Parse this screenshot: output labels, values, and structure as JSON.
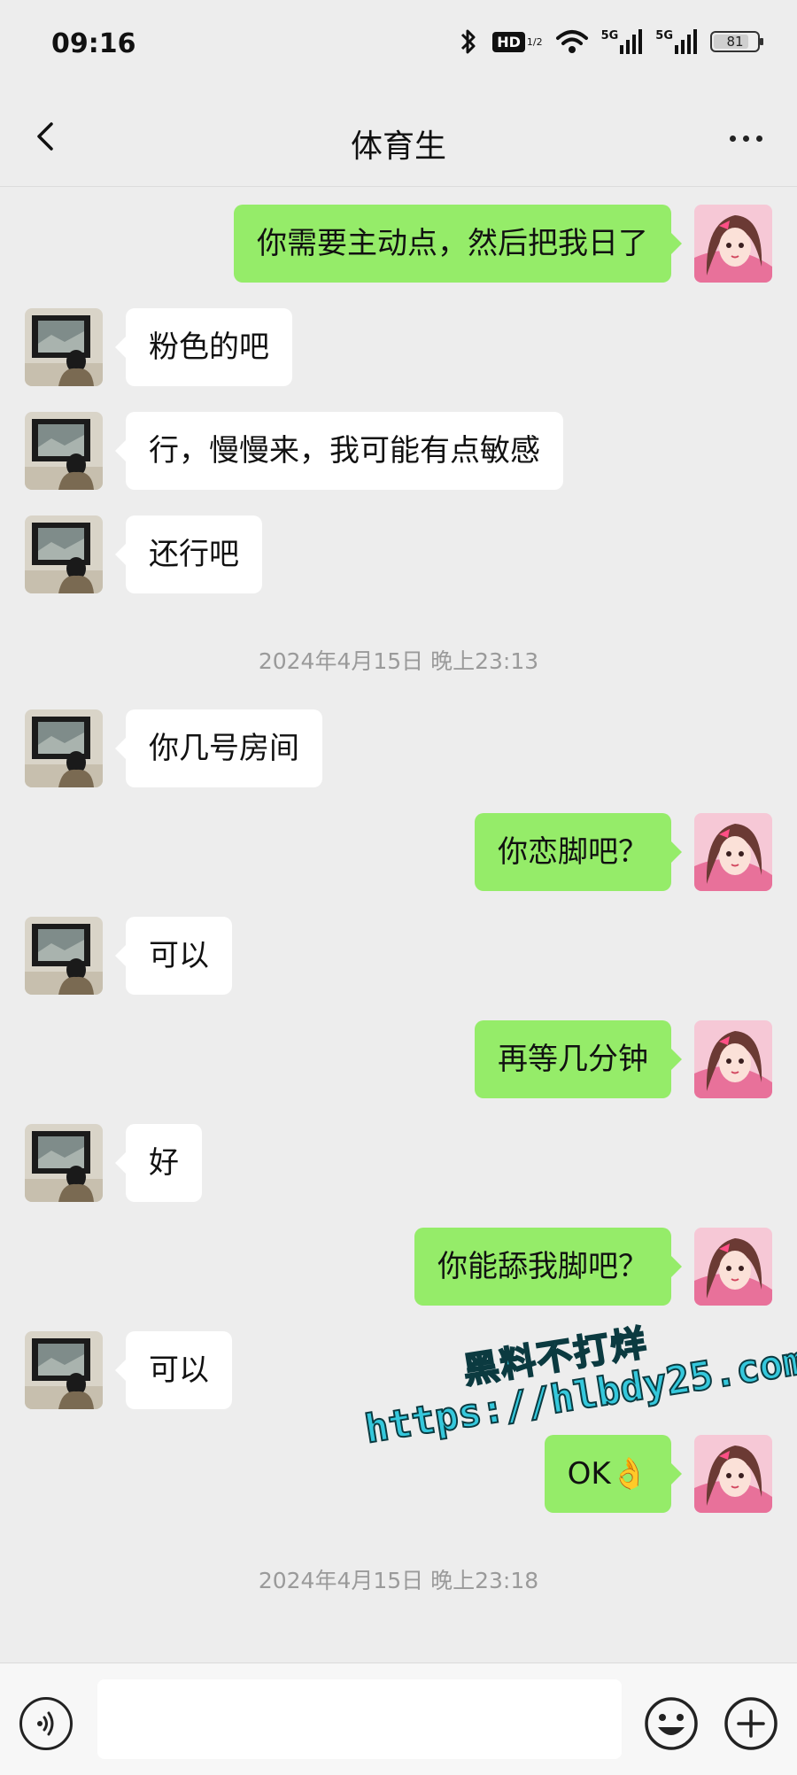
{
  "status_bar": {
    "time": "09:16",
    "hd_label": "HD",
    "hd_sub": "1/2",
    "signal1_label": "5G",
    "signal2_label": "5G",
    "battery": "81",
    "battery_level": 0.81
  },
  "header": {
    "title": "体育生",
    "back_icon": "chevron-left-icon",
    "more_icon": "more-dots-icon"
  },
  "messages": [
    {
      "from": "me",
      "text": "你需要主动点，然后把我日了"
    },
    {
      "from": "them",
      "text": "粉色的吧"
    },
    {
      "from": "them",
      "text": "行，慢慢来，我可能有点敏感"
    },
    {
      "from": "them",
      "text": "还行吧"
    },
    {
      "type": "time",
      "text": "2024年4月15日 晚上23:13"
    },
    {
      "from": "them",
      "text": "你几号房间"
    },
    {
      "from": "me",
      "text": "你恋脚吧？"
    },
    {
      "from": "them",
      "text": "可以"
    },
    {
      "from": "me",
      "text": "再等几分钟"
    },
    {
      "from": "them",
      "text": "好"
    },
    {
      "from": "me",
      "text": "你能舔我脚吧？"
    },
    {
      "from": "them",
      "text": "可以"
    },
    {
      "from": "me",
      "text": "OK👌"
    },
    {
      "type": "time",
      "text": "2024年4月15日 晚上23:18"
    }
  ],
  "watermark": {
    "line1": "黑料不打烊",
    "line2": "https://hlbdy25.com"
  },
  "input_bar": {
    "voice_icon": "voice-icon",
    "emoji_icon": "emoji-icon",
    "plus_icon": "plus-icon",
    "placeholder": ""
  },
  "colors": {
    "background": "#ededed",
    "my_bubble": "#95ec69",
    "their_bubble": "#ffffff",
    "timestamp": "#9a9a9a"
  }
}
